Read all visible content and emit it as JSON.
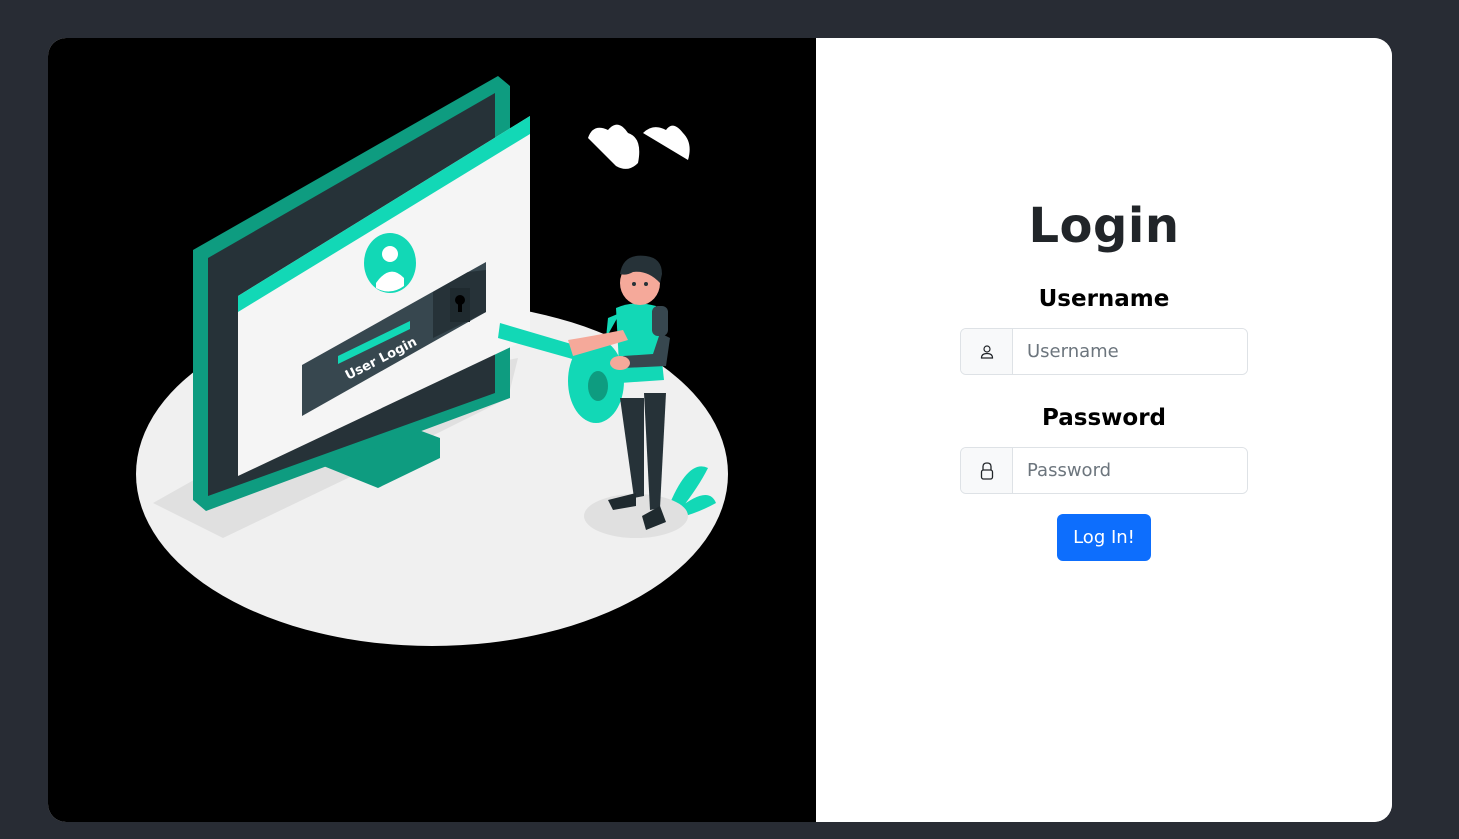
{
  "illustration": {
    "screen_text": "User Login",
    "colors": {
      "accent": "#12d8b6",
      "accent_dark": "#0e9c80",
      "monitor_dark": "#263238",
      "platform": "#f0f0f0"
    }
  },
  "form": {
    "title": "Login",
    "username": {
      "label": "Username",
      "placeholder": "Username",
      "value": "",
      "icon": "user-icon"
    },
    "password": {
      "label": "Password",
      "placeholder": "Password",
      "value": "",
      "icon": "lock-icon"
    },
    "submit_label": "Log In!"
  },
  "colors": {
    "page_background": "#282c34",
    "button": "#0d6efd",
    "title": "#212529"
  }
}
